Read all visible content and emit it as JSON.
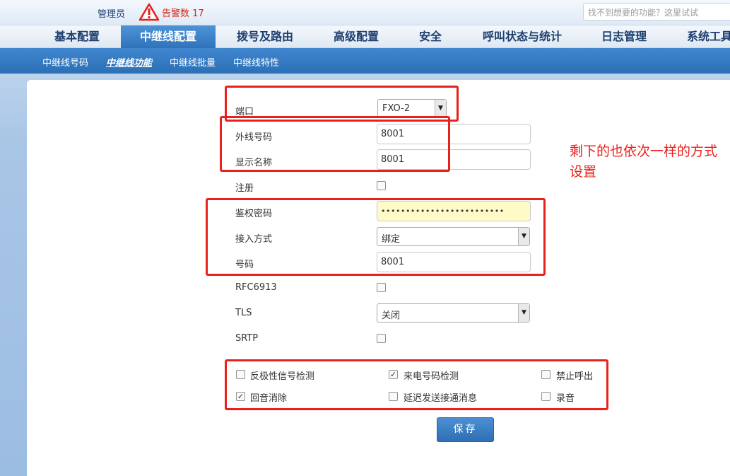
{
  "header": {
    "admin_label": "管理员",
    "alarm_label": "告警数",
    "alarm_count": "17",
    "search_placeholder": "找不到想要的功能？这里试试"
  },
  "main_nav": [
    {
      "label": "基本配置"
    },
    {
      "label": "中继线配置",
      "active": true
    },
    {
      "label": "拨号及路由"
    },
    {
      "label": "高级配置"
    },
    {
      "label": "安全"
    },
    {
      "label": "呼叫状态与统计"
    },
    {
      "label": "日志管理"
    },
    {
      "label": "系统工具"
    }
  ],
  "sub_nav": [
    {
      "label": "中继线号码"
    },
    {
      "label": "中继线功能",
      "active": true
    },
    {
      "label": "中继线批量"
    },
    {
      "label": "中继线特性"
    }
  ],
  "form": {
    "port": {
      "label": "端口",
      "value": "FXO-2"
    },
    "external_number": {
      "label": "外线号码",
      "value": "8001"
    },
    "display_name": {
      "label": "显示名称",
      "value": "8001"
    },
    "register": {
      "label": "注册",
      "checked": false
    },
    "auth_password": {
      "label": "鉴权密码",
      "value": "•••••••••••••••••••••••••"
    },
    "access_mode": {
      "label": "接入方式",
      "value": "绑定"
    },
    "number": {
      "label": "号码",
      "value": "8001"
    },
    "rfc6913": {
      "label": "RFC6913",
      "checked": false
    },
    "tls": {
      "label": "TLS",
      "value": "关闭"
    },
    "srtp": {
      "label": "SRTP",
      "checked": false
    }
  },
  "options": [
    {
      "label": "反极性信号检测",
      "checked": false
    },
    {
      "label": "来电号码检测",
      "checked": true
    },
    {
      "label": "禁止呼出",
      "checked": false
    },
    {
      "label": "回音消除",
      "checked": true
    },
    {
      "label": "延迟发送接通消息",
      "checked": false
    },
    {
      "label": "录音",
      "checked": false
    }
  ],
  "save_label": "保存",
  "annotation": "剩下的也依次一样的方式设置",
  "colors": {
    "accent": "#2f74bb",
    "alert": "#e8211c",
    "password_bg": "#fffbc8"
  }
}
